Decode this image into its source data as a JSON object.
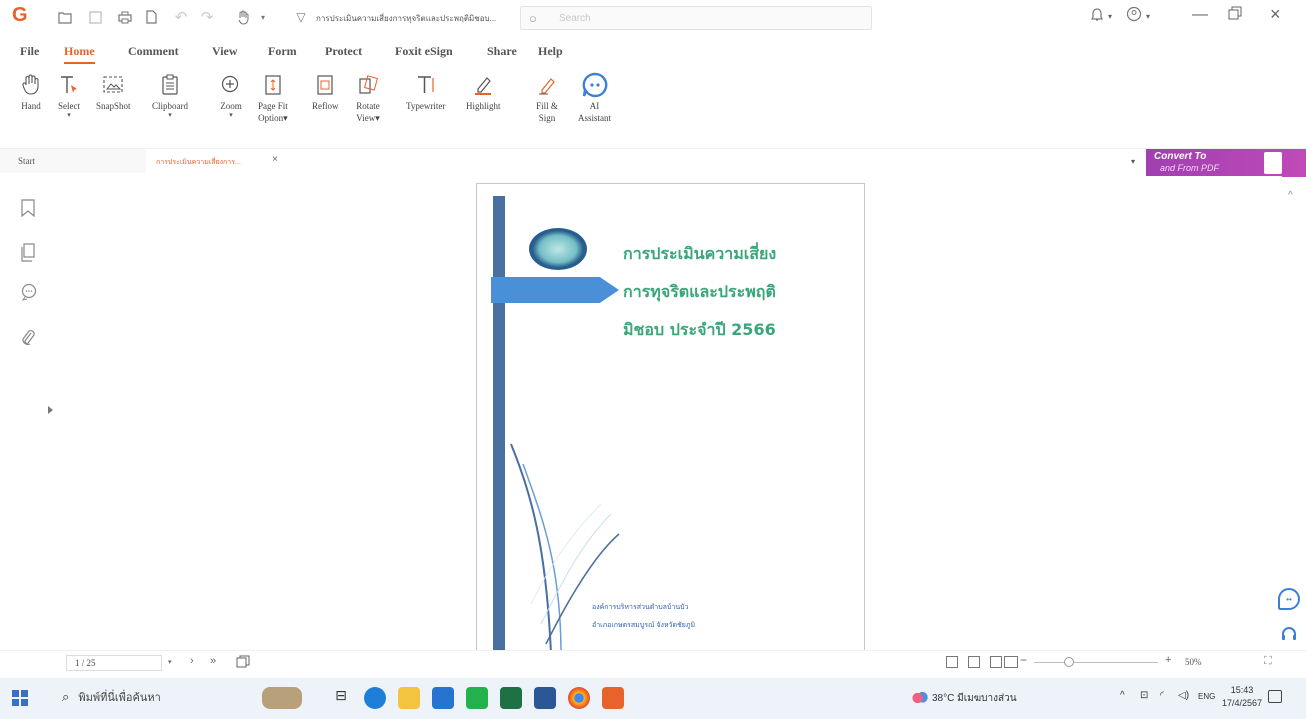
{
  "titlebar": {
    "document_title": "การประเมินความเสี่ยงการทุจริตและประพฤติมิชอบ...",
    "search_placeholder": "Search"
  },
  "menu": {
    "tabs": [
      {
        "label": "File"
      },
      {
        "label": "Home"
      },
      {
        "label": "Comment"
      },
      {
        "label": "View"
      },
      {
        "label": "Form"
      },
      {
        "label": "Protect"
      },
      {
        "label": "Foxit eSign"
      },
      {
        "label": "Share"
      },
      {
        "label": "Help"
      }
    ],
    "active": "Home"
  },
  "ribbon": {
    "hand": "Hand",
    "select": "Select",
    "snapshot": "SnapShot",
    "clipboard": "Clipboard",
    "zoom": "Zoom",
    "page_fit_1": "Page Fit",
    "page_fit_2": "Option",
    "reflow": "Reflow",
    "rotate_1": "Rotate",
    "rotate_2": "View",
    "typewriter": "Typewriter",
    "highlight": "Highlight",
    "fill_1": "Fill &",
    "fill_2": "Sign",
    "ai_1": "AI",
    "ai_2": "Assistant"
  },
  "doc_tabs": {
    "start": "Start",
    "file": "การประเมินความเสี่ยงการ..."
  },
  "convert_banner": {
    "line1": "Convert To",
    "line2": "and From PDF"
  },
  "page": {
    "title_lines": [
      "การประเมินความเสี่ยง",
      "การทุจริตและประพฤติ",
      "มิชอบ ประจำปี 2566"
    ],
    "org_lines": [
      "องค์การบริหารส่วนตำบลบ้านบัว",
      "อำเภอเกษตรสมบูรณ์ จังหวัดชัยภูมิ"
    ]
  },
  "statusbar": {
    "page_indicator": "1 / 25",
    "zoom": "50%"
  },
  "taskbar": {
    "search_text": "พิมพ์ที่นี่เพื่อค้นหา",
    "weather": "38°C มีเมฆบางส่วน",
    "lang": "ENG",
    "time": "15:43",
    "date": "17/4/2567"
  },
  "colors": {
    "accent": "#e8632b",
    "page_title": "#3aa67a",
    "page_bar": "#4a6fa1",
    "page_arrow": "#4a90d9",
    "convert_banner": "#b044b5"
  }
}
